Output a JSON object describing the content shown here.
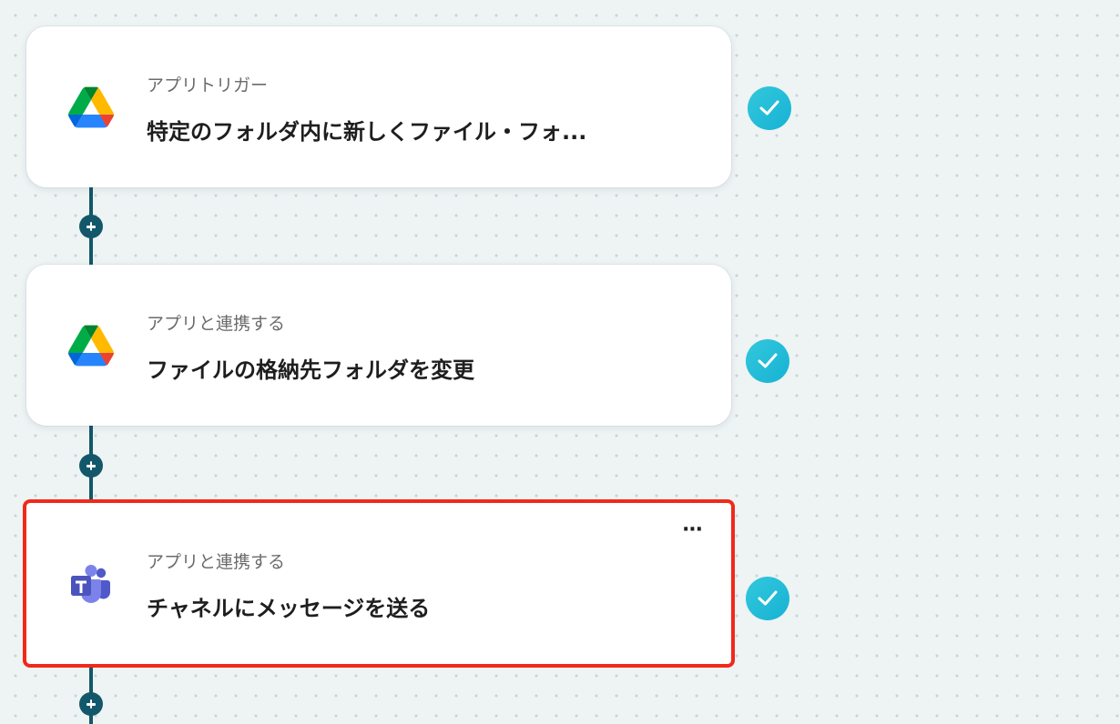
{
  "flow": {
    "steps": [
      {
        "subtitle": "アプリトリガー",
        "title": "特定のフォルダ内に新しくファイル・フォ...",
        "app": "google-drive",
        "icon": "google-drive-icon",
        "status": "completed"
      },
      {
        "subtitle": "アプリと連携する",
        "title": "ファイルの格納先フォルダを変更",
        "app": "google-drive",
        "icon": "google-drive-icon",
        "status": "completed"
      },
      {
        "subtitle": "アプリと連携する",
        "title": "チャネルにメッセージを送る",
        "app": "microsoft-teams",
        "icon": "microsoft-teams-icon",
        "status": "completed",
        "selected": true,
        "menu_label": "···"
      }
    ]
  },
  "colors": {
    "connector": "#12586a",
    "check_badge": "#1fbfd8",
    "selection_outline": "#f0291a",
    "background": "#eef3f4"
  }
}
